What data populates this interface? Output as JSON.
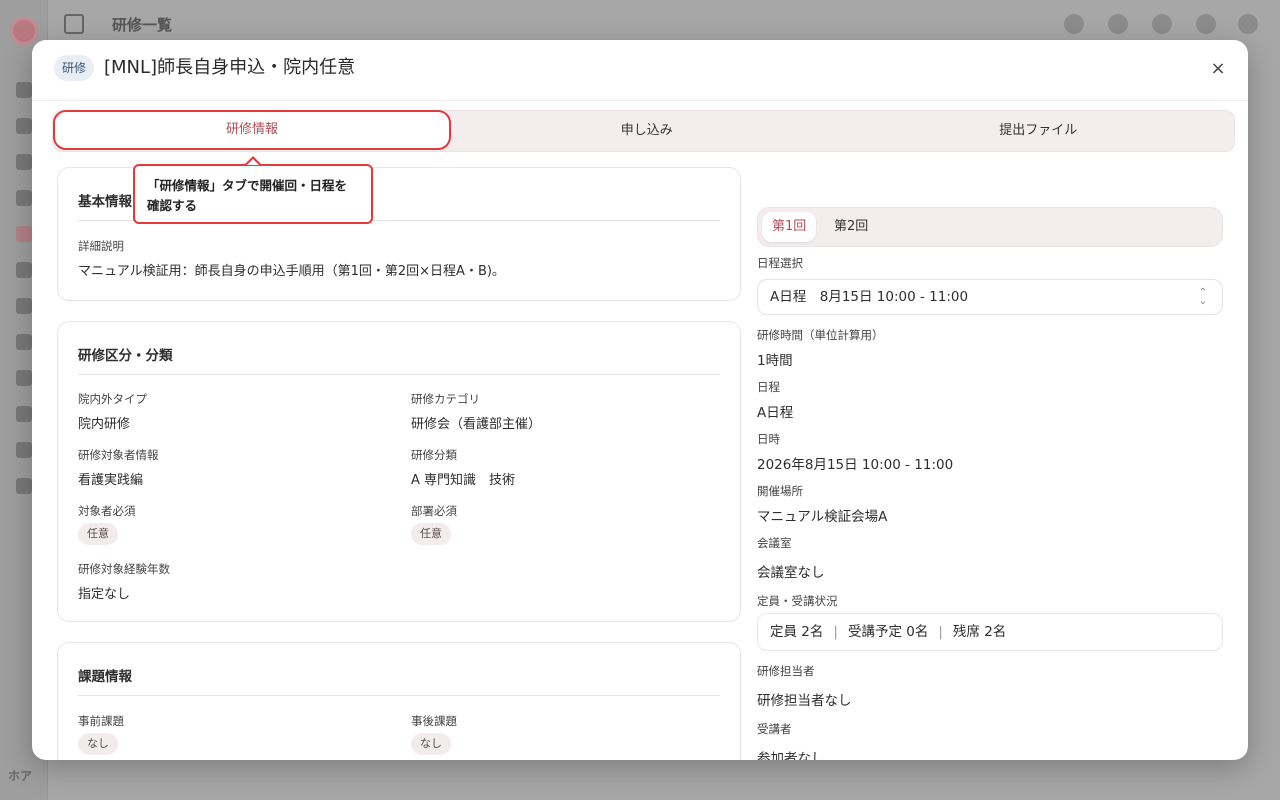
{
  "background": {
    "page_title": "研修一覧",
    "footer_text": "ホア"
  },
  "modal": {
    "category_badge": "研修",
    "title": "[MNL]師長自身申込・院内任意",
    "close_label": "×"
  },
  "tabs": [
    {
      "label": "研修情報",
      "active": true
    },
    {
      "label": "申し込み",
      "active": false
    },
    {
      "label": "提出ファイル",
      "active": false
    }
  ],
  "tooltip": {
    "line1": "「研修情報」タブで開催回・日程を",
    "line2": "確認する"
  },
  "basic_info": {
    "title": "基本情報",
    "detail_label": "詳細説明",
    "detail_value": "マニュアル検証用：師長自身の申込手順用（第1回・第2回×日程A・B)。"
  },
  "classification": {
    "title": "研修区分・分類",
    "inout_type_label": "院内外タイプ",
    "inout_type_value": "院内研修",
    "category_label": "研修カテゴリ",
    "category_value": "研修会（看護部主催）",
    "target_info_label": "研修対象者情報",
    "target_info_value": "看護実践編",
    "classification_label": "研修分類",
    "classification_value": "A 専門知識　技術",
    "target_required_label": "対象者必須",
    "target_required_value": "任意",
    "dept_required_label": "部署必須",
    "dept_required_value": "任意",
    "experience_label": "研修対象経験年数",
    "experience_value": "指定なし"
  },
  "assignment": {
    "title": "課題情報",
    "pre_label": "事前課題",
    "pre_value": "なし",
    "post_label": "事後課題",
    "post_value": "なし"
  },
  "rounds": [
    {
      "label": "第1回",
      "active": true
    },
    {
      "label": "第2回",
      "active": false
    }
  ],
  "schedule": {
    "select_label": "日程選択",
    "select_value": "A日程　8月15日 10:00 - 11:00",
    "hours_label": "研修時間（単位計算用）",
    "hours_value": "1時間",
    "schedule_label": "日程",
    "schedule_value": "A日程",
    "datetime_label": "日時",
    "datetime_value": "2026年8月15日 10:00 - 11:00",
    "venue_label": "開催場所",
    "venue_value": "マニュアル検証会場A",
    "room_label": "会議室",
    "room_value": "会議室なし",
    "capacity_label": "定員・受講状況",
    "capacity": "定員 2名",
    "planned": "受講予定 0名",
    "remaining": "残席 2名",
    "separator": "|",
    "staff_label": "研修担当者",
    "staff_value": "研修担当者なし",
    "attendees_label": "受講者",
    "attendees_value": "参加者なし"
  },
  "colors": {
    "accent": "#b14d5a",
    "highlight": "#e33a3a"
  }
}
